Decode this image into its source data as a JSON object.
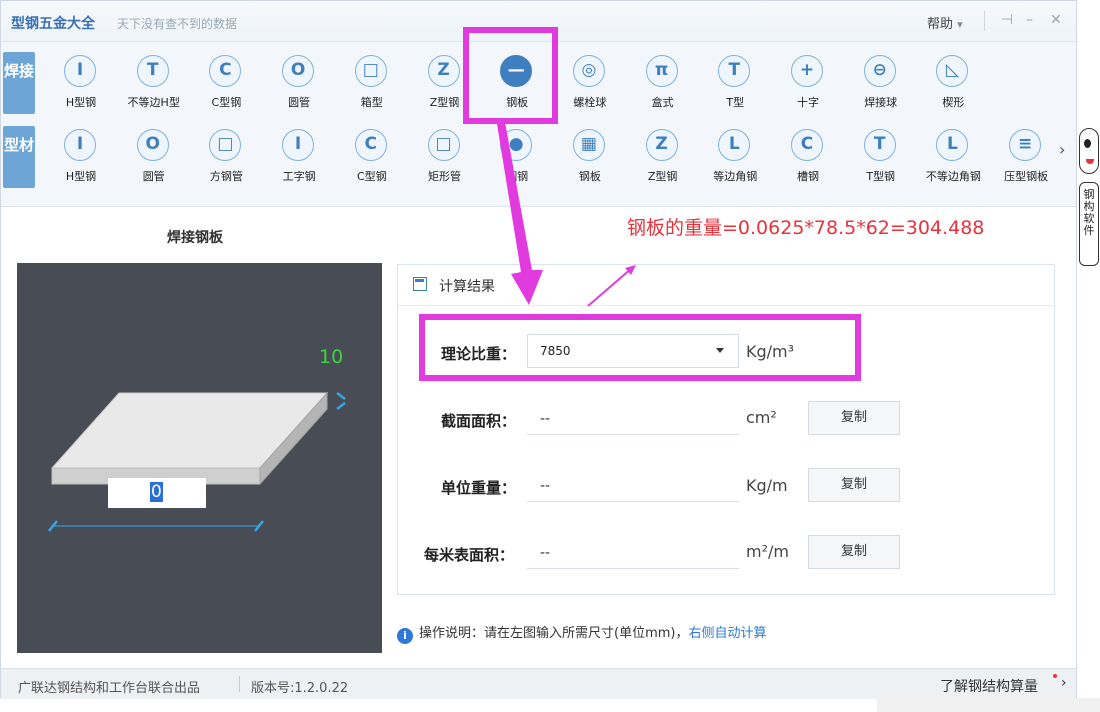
{
  "titlebar": {
    "title": "型钢五金大全",
    "subtitle": "天下没有查不到的数据",
    "help_label": "帮助",
    "help_caret": "▾",
    "pin_icon": "⊣",
    "minimize_icon": "–",
    "close_icon": "✕"
  },
  "toolbar": {
    "row1_tag": "焊接",
    "row2_tag": "型材",
    "row1": [
      {
        "label": "H型钢",
        "glyph": "I",
        "icon": "h-beam-icon"
      },
      {
        "label": "不等边H型",
        "glyph": "T",
        "icon": "unequal-h-beam-icon"
      },
      {
        "label": "C型钢",
        "glyph": "C",
        "icon": "c-channel-icon"
      },
      {
        "label": "圆管",
        "glyph": "O",
        "icon": "round-tube-icon"
      },
      {
        "label": "箱型",
        "glyph": "□",
        "icon": "box-section-icon"
      },
      {
        "label": "Z型钢",
        "glyph": "Z",
        "icon": "z-section-icon"
      },
      {
        "label": "钢板",
        "glyph": "—",
        "icon": "steel-plate-icon",
        "active": true
      },
      {
        "label": "螺栓球",
        "glyph": "◎",
        "icon": "bolt-ball-icon"
      },
      {
        "label": "盒式",
        "glyph": "π",
        "icon": "box-type-icon"
      },
      {
        "label": "T型",
        "glyph": "T",
        "icon": "t-section-icon"
      },
      {
        "label": "十字",
        "glyph": "+",
        "icon": "cross-section-icon"
      },
      {
        "label": "焊接球",
        "glyph": "⊖",
        "icon": "welded-ball-icon"
      },
      {
        "label": "楔形",
        "glyph": "◺",
        "icon": "wedge-icon"
      }
    ],
    "row2": [
      {
        "label": "H型钢",
        "glyph": "I",
        "icon": "h-beam-icon"
      },
      {
        "label": "圆管",
        "glyph": "O",
        "icon": "round-tube-icon"
      },
      {
        "label": "方钢管",
        "glyph": "□",
        "icon": "square-tube-icon"
      },
      {
        "label": "工字钢",
        "glyph": "I",
        "icon": "i-beam-icon"
      },
      {
        "label": "C型钢",
        "glyph": "C",
        "icon": "c-channel-icon"
      },
      {
        "label": "矩形管",
        "glyph": "□",
        "icon": "rect-tube-icon"
      },
      {
        "label": "圆钢",
        "glyph": "●",
        "icon": "round-bar-icon"
      },
      {
        "label": "钢板",
        "glyph": "▦",
        "icon": "plate-icon"
      },
      {
        "label": "Z型钢",
        "glyph": "Z",
        "icon": "z-section-icon"
      },
      {
        "label": "等边角钢",
        "glyph": "L",
        "icon": "equal-angle-icon"
      },
      {
        "label": "槽钢",
        "glyph": "C",
        "icon": "channel-icon"
      },
      {
        "label": "T型钢",
        "glyph": "T",
        "icon": "t-steel-icon"
      },
      {
        "label": "不等边角钢",
        "glyph": "L",
        "icon": "unequal-angle-icon"
      },
      {
        "label": "压型钢板",
        "glyph": "≡",
        "icon": "profiled-sheet-icon"
      }
    ],
    "next_arrow": "›"
  },
  "left_panel": {
    "title": "焊接钢板",
    "thickness_value": "10",
    "width_value": "0"
  },
  "annotation": {
    "text": "钢板的重量=0.0625*78.5*62=304.488",
    "color": "#e8323b"
  },
  "results": {
    "title": "计算结果",
    "fields": [
      {
        "label": "理论比重：",
        "value": "7850",
        "unit": "Kg/m³"
      },
      {
        "label": "截面面积：",
        "value": "--",
        "unit": "cm²",
        "button": "复制"
      },
      {
        "label": "单位重量：",
        "value": "--",
        "unit": "Kg/m",
        "button": "复制"
      },
      {
        "label": "每米表面积：",
        "value": "--",
        "unit": "m²/m",
        "button": "复制"
      }
    ]
  },
  "info": {
    "icon": "i",
    "text": "操作说明：请在左图输入所需尺寸(单位mm)，",
    "link": "右侧自动计算"
  },
  "footer": {
    "credit": "广联达钢结构和工作台联合出品",
    "version": "版本号:1.2.0.22",
    "learn_link": "了解钢结构算量",
    "arrow": "›"
  },
  "mascot": {
    "text": "钢构软件"
  },
  "colors": {
    "accent": "#3f7fc0",
    "highlight": "#e13be0",
    "drawing_bg": "#474c55",
    "dim_green": "#3fd43f"
  }
}
